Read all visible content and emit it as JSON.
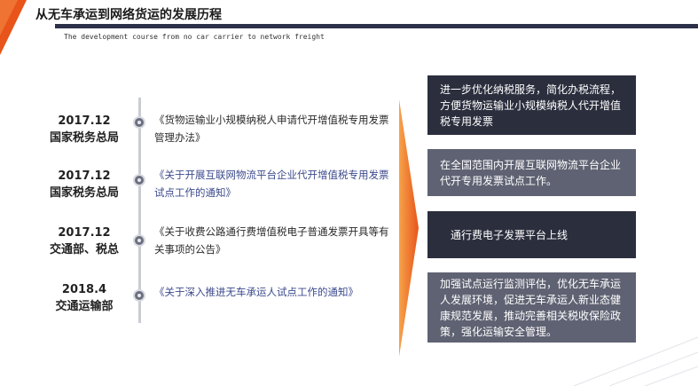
{
  "header": {
    "title": "从无车承运到网络货运的发展历程",
    "subtitle": "The development course from no car carrier to network freight"
  },
  "colors": {
    "accent": "#f07b1c",
    "dark_box": "#2b2e3d",
    "gray_box": "#5f6272"
  },
  "timeline": [
    {
      "date": "2017.12",
      "org": "国家税务总局",
      "doc": "《货物运输业小规模纳税人申请代开增值税专用发票管理办法》",
      "result": "进一步优化纳税服务，简化办税流程，方便货物运输业小规模纳税人代开增值税专用发票"
    },
    {
      "date": "2017.12",
      "org": "国家税务总局",
      "doc": "《关于开展互联网物流平台企业代开增值税专用发票试点工作的通知》",
      "result": "在全国范围内开展互联网物流平台企业代开专用发票试点工作。"
    },
    {
      "date": "2017.12",
      "org": "交通部、税总",
      "doc": "《关于收费公路通行费增值税电子普通发票开具等有关事项的公告》",
      "result": "通行费电子发票平台上线"
    },
    {
      "date": "2018.4",
      "org": "交通运输部",
      "doc": "《关于深入推进无车承运人试点工作的通知》",
      "result": "加强试点运行监测评估，优化无车承运人发展环境，促进无车承运人新业态健康规范发展，推动完善相关税收保险政策，强化运输安全管理。"
    }
  ]
}
